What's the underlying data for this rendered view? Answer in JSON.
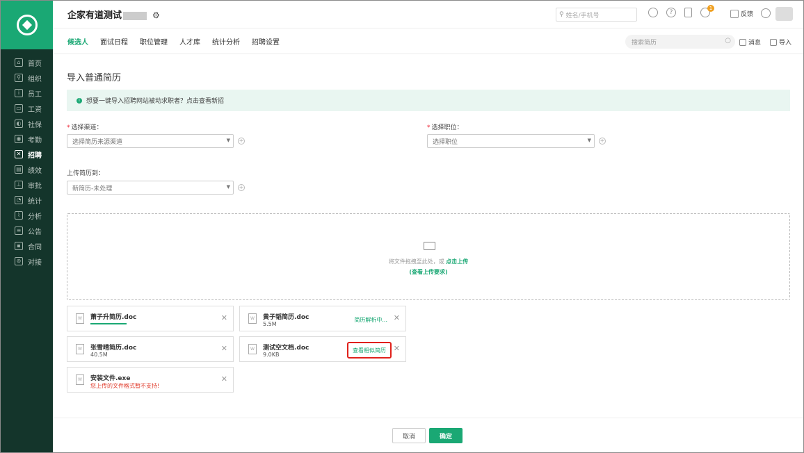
{
  "sidebar": {
    "items": [
      {
        "label": "首页",
        "icon": "home-icon"
      },
      {
        "label": "组织",
        "icon": "org-icon"
      },
      {
        "label": "员工",
        "icon": "employee-icon"
      },
      {
        "label": "工资",
        "icon": "wallet-icon"
      },
      {
        "label": "社保",
        "icon": "shield-icon"
      },
      {
        "label": "考勤",
        "icon": "location-icon"
      },
      {
        "label": "招聘",
        "icon": "recruit-icon"
      },
      {
        "label": "绩效",
        "icon": "performance-icon"
      },
      {
        "label": "审批",
        "icon": "stamp-icon"
      },
      {
        "label": "统计",
        "icon": "pie-icon"
      },
      {
        "label": "分析",
        "icon": "chart-icon"
      },
      {
        "label": "公告",
        "icon": "notice-icon"
      },
      {
        "label": "合同",
        "icon": "contract-icon"
      },
      {
        "label": "对接",
        "icon": "link-icon"
      }
    ],
    "active_index": 6
  },
  "header": {
    "company": "企家有道测试",
    "search_placeholder": "姓名/手机号",
    "notification_count": "1",
    "feedback": "反馈"
  },
  "tabs": [
    "候选人",
    "面试日程",
    "职位管理",
    "人才库",
    "统计分析",
    "招聘设置"
  ],
  "tabs_right": {
    "search_placeholder": "搜索简历",
    "message": "消息",
    "import": "导入"
  },
  "page": {
    "title": "导入普通简历",
    "notice": "想要一键导入招聘网站被动求职者？点击查看新招"
  },
  "form": {
    "channel_label": "选择渠道：",
    "channel_placeholder": "选择简历来源渠道",
    "position_label": "选择职位：",
    "position_placeholder": "选择职位",
    "upload_to_label": "上传简历到：",
    "upload_to_value": "新简历-未处理"
  },
  "dropzone": {
    "text": "将文件拖拽至此处，或",
    "link": "点击上传",
    "requirements": "(查看上传要求)"
  },
  "files": [
    {
      "name": "萧子升简历.doc",
      "size": "",
      "status": "",
      "uploading": true
    },
    {
      "name": "黄子韬简历.doc",
      "size": "5.5M",
      "status": "简历解析中..."
    },
    {
      "name": "张雪晴简历.doc",
      "size": "40.5M",
      "status": ""
    },
    {
      "name": "测试空文档.doc",
      "size": "9.0KB",
      "status": "查看相似简历"
    },
    {
      "name": "安装文件.exe",
      "size": "",
      "error": "您上传的文件格式暂不支持!"
    }
  ],
  "footer": {
    "cancel": "取消",
    "confirm": "确定"
  },
  "colors": {
    "accent": "#1aa874",
    "sidebar": "#14352b",
    "error": "#e03a2a",
    "highlight": "#e0201a"
  }
}
